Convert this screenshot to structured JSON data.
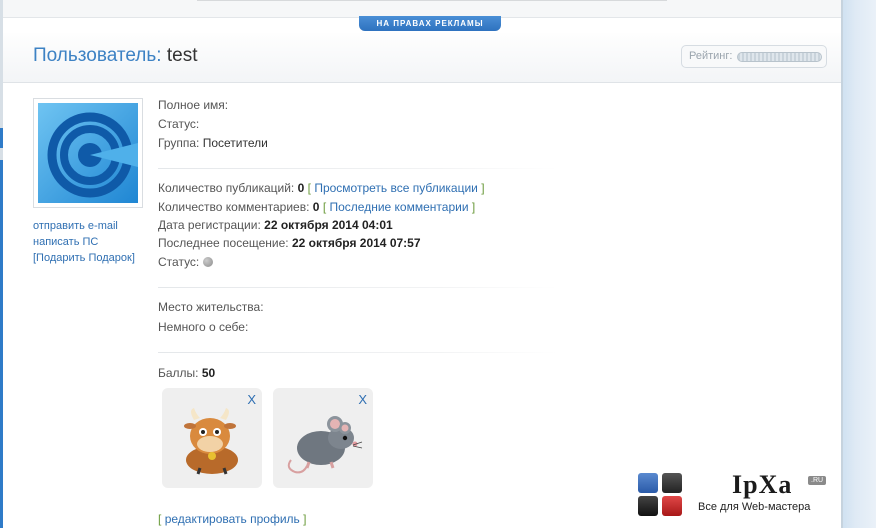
{
  "ad_badge": "НА ПРАВАХ РЕКЛАМЫ",
  "header": {
    "title_label": "Пользователь:",
    "username": "test",
    "rating_label": "Рейтинг:"
  },
  "sidebar": {
    "send_email": "отправить e-mail",
    "send_pm": "написать ПС",
    "gift": "[Подарить Подарок]"
  },
  "profile": {
    "full_name_label": "Полное имя:",
    "status_label": "Статус:",
    "group_label": "Группа:",
    "group_value": "Посетители",
    "pubs_label": "Количество публикаций:",
    "pubs_value": "0",
    "pubs_link": "Просмотреть все публикации",
    "comments_label": "Количество комментариев:",
    "comments_value": "0",
    "comments_link": "Последние комментарии",
    "reg_label": "Дата регистрации:",
    "reg_value": "22 октября 2014 04:01",
    "last_label": "Последнее посещение:",
    "last_value": "22 октября 2014 07:57",
    "status2_label": "Статус:",
    "location_label": "Место жительства:",
    "about_label": "Немного о себе:",
    "points_label": "Баллы:",
    "points_value": "50",
    "edit_link": "редактировать профиль"
  },
  "gifts": [
    {
      "name": "cow",
      "remove": "X"
    },
    {
      "name": "rat",
      "remove": "X"
    }
  ],
  "logo": {
    "name": "IpXa",
    "tld": ".RU",
    "tagline": "Все для Web-мастера"
  },
  "colors": {
    "accent": "#3d82c4",
    "link": "#2f6fb2",
    "bracket": "#6a9a3a"
  }
}
